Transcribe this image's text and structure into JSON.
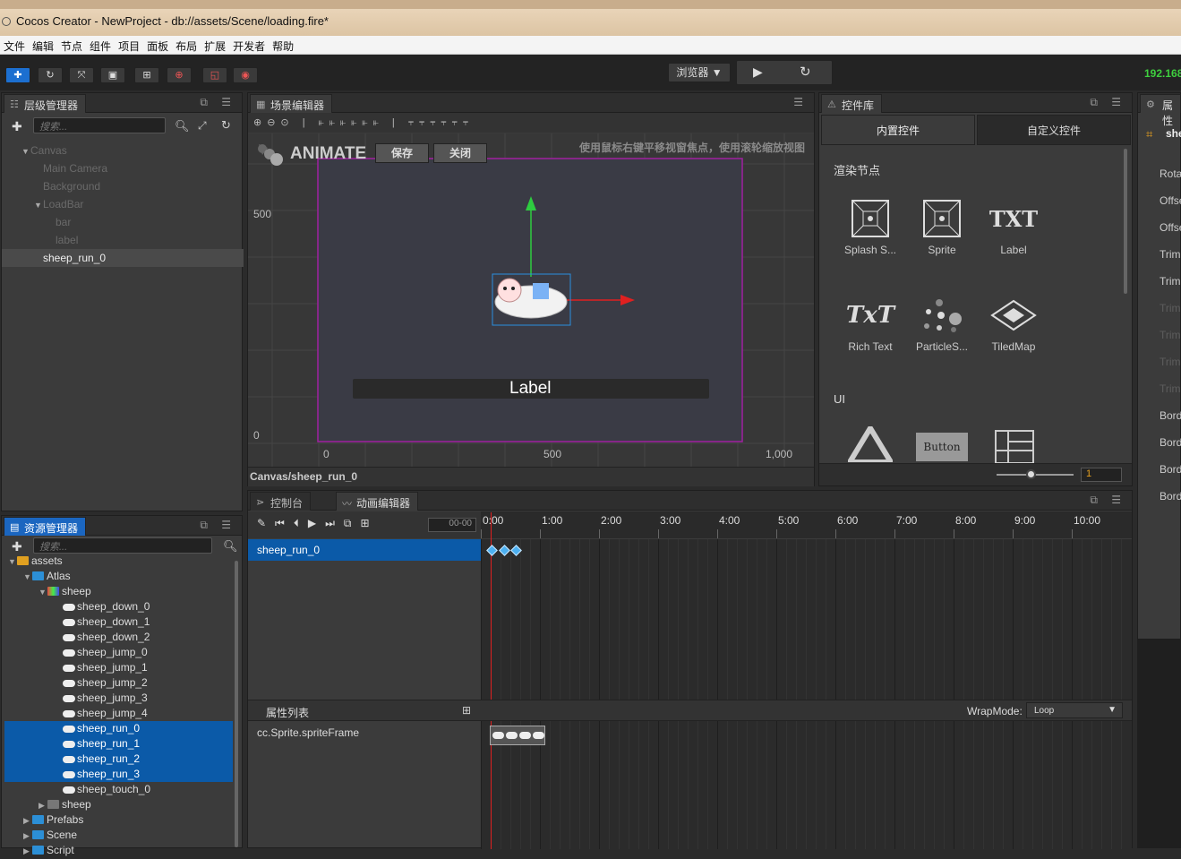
{
  "window": {
    "title": "Cocos Creator - NewProject - db://assets/Scene/loading.fire*"
  },
  "menu": [
    "文件",
    "编辑",
    "节点",
    "组件",
    "项目",
    "面板",
    "布局",
    "扩展",
    "开发者",
    "帮助"
  ],
  "toolbar": {
    "preview_target": "浏览器 ▼",
    "ip": "192.168"
  },
  "hierarchy": {
    "title": "层级管理器",
    "search_placeholder": "搜索...",
    "nodes": [
      {
        "label": "Canvas",
        "depth": 1,
        "fold": "▼"
      },
      {
        "label": "Main Camera",
        "depth": 2,
        "fold": ""
      },
      {
        "label": "Background",
        "depth": 2,
        "fold": ""
      },
      {
        "label": "LoadBar",
        "depth": 2,
        "fold": "▼"
      },
      {
        "label": "bar",
        "depth": 3,
        "fold": ""
      },
      {
        "label": "label",
        "depth": 3,
        "fold": ""
      },
      {
        "label": "sheep_run_0",
        "depth": 2,
        "fold": "",
        "selected": true
      }
    ]
  },
  "scene": {
    "title": "场景编辑器",
    "animate_label": "ANIMATE",
    "save_button": "保存",
    "close_button": "关闭",
    "hint": "使用鼠标右键平移视窗焦点，使用滚轮缩放视图",
    "y_tick_500": "500",
    "y_tick_0": "0",
    "x_tick_0": "0",
    "x_tick_500": "500",
    "x_tick_1000": "1,000",
    "label_text": "Label",
    "breadcrumb": "Canvas/sheep_run_0"
  },
  "widgets": {
    "title": "控件库",
    "tab_builtin": "内置控件",
    "tab_custom": "自定义控件",
    "section_render": "渲染节点",
    "section_ui": "UI",
    "items": [
      {
        "label": "Splash S...",
        "icon": "splash-sprite-icon"
      },
      {
        "label": "Sprite",
        "icon": "sprite-icon"
      },
      {
        "label": "Label",
        "icon": "label-icon",
        "glyph": "TXT"
      },
      {
        "label": "Rich Text",
        "icon": "rich-text-icon",
        "glyph": "TxT"
      },
      {
        "label": "ParticleS...",
        "icon": "particle-icon"
      },
      {
        "label": "TiledMap",
        "icon": "tiledmap-icon"
      }
    ],
    "ui_button_label": "Button",
    "zoom_value": "1"
  },
  "inspector": {
    "title": "属性",
    "node_name": "she",
    "rows": [
      {
        "label": "Rota",
        "dim": false
      },
      {
        "label": "Offse",
        "dim": false
      },
      {
        "label": "Offse",
        "dim": false
      },
      {
        "label": "Trim",
        "dim": false
      },
      {
        "label": "Trim",
        "dim": false
      },
      {
        "label": "Trim",
        "dim": true
      },
      {
        "label": "Trim",
        "dim": true
      },
      {
        "label": "Trim",
        "dim": true
      },
      {
        "label": "Trim",
        "dim": true
      },
      {
        "label": "Bord",
        "dim": false
      },
      {
        "label": "Bord",
        "dim": false
      },
      {
        "label": "Bord",
        "dim": false
      },
      {
        "label": "Bord",
        "dim": false
      }
    ]
  },
  "assets": {
    "title": "资源管理器",
    "search_placeholder": "搜索...",
    "items": [
      {
        "label": "assets",
        "depth": 0,
        "fold": "▼",
        "kind": "db"
      },
      {
        "label": "Atlas",
        "depth": 1,
        "fold": "▼",
        "kind": "folder"
      },
      {
        "label": "sheep",
        "depth": 2,
        "fold": "▼",
        "kind": "atlas"
      },
      {
        "label": "sheep_down_0",
        "depth": 3,
        "fold": "",
        "kind": "sprite"
      },
      {
        "label": "sheep_down_1",
        "depth": 3,
        "fold": "",
        "kind": "sprite"
      },
      {
        "label": "sheep_down_2",
        "depth": 3,
        "fold": "",
        "kind": "sprite"
      },
      {
        "label": "sheep_jump_0",
        "depth": 3,
        "fold": "",
        "kind": "sprite"
      },
      {
        "label": "sheep_jump_1",
        "depth": 3,
        "fold": "",
        "kind": "sprite"
      },
      {
        "label": "sheep_jump_2",
        "depth": 3,
        "fold": "",
        "kind": "sprite"
      },
      {
        "label": "sheep_jump_3",
        "depth": 3,
        "fold": "",
        "kind": "sprite"
      },
      {
        "label": "sheep_jump_4",
        "depth": 3,
        "fold": "",
        "kind": "sprite"
      },
      {
        "label": "sheep_run_0",
        "depth": 3,
        "fold": "",
        "kind": "sprite",
        "selected": true
      },
      {
        "label": "sheep_run_1",
        "depth": 3,
        "fold": "",
        "kind": "sprite",
        "selected": true
      },
      {
        "label": "sheep_run_2",
        "depth": 3,
        "fold": "",
        "kind": "sprite",
        "selected": true
      },
      {
        "label": "sheep_run_3",
        "depth": 3,
        "fold": "",
        "kind": "sprite",
        "selected": true
      },
      {
        "label": "sheep_touch_0",
        "depth": 3,
        "fold": "",
        "kind": "sprite"
      },
      {
        "label": "sheep",
        "depth": 2,
        "fold": "▶",
        "kind": "anim"
      },
      {
        "label": "Prefabs",
        "depth": 1,
        "fold": "▶",
        "kind": "folder"
      },
      {
        "label": "Scene",
        "depth": 1,
        "fold": "▶",
        "kind": "folder"
      },
      {
        "label": "Script",
        "depth": 1,
        "fold": "▶",
        "kind": "folder"
      }
    ]
  },
  "timeline": {
    "tab_console": "控制台",
    "tab_anim": "动画编辑器",
    "time_input": "00-00",
    "ticks": [
      "0:00",
      "1:00",
      "2:00",
      "3:00",
      "4:00",
      "5:00",
      "6:00",
      "7:00",
      "8:00",
      "9:00",
      "10:00"
    ],
    "node_row": "sheep_run_0",
    "props_title": "属性列表",
    "wrapmode_label": "WrapMode:",
    "wrapmode_value": "Loop",
    "prop_row": "cc.Sprite.spriteFrame"
  }
}
